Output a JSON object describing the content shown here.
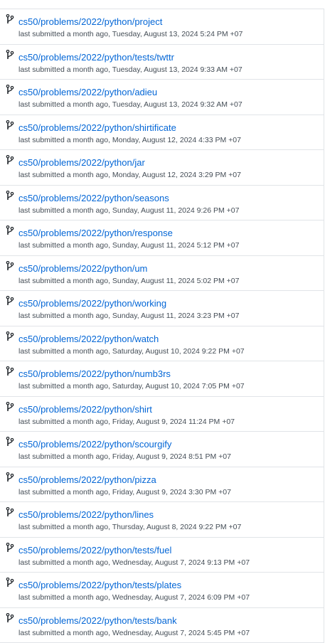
{
  "submissions": [
    {
      "repo": "cs50/problems/2022/python/project",
      "submitted": "last submitted a month ago, Tuesday, August 13, 2024 5:24 PM +07"
    },
    {
      "repo": "cs50/problems/2022/python/tests/twttr",
      "submitted": "last submitted a month ago, Tuesday, August 13, 2024 9:33 AM +07"
    },
    {
      "repo": "cs50/problems/2022/python/adieu",
      "submitted": "last submitted a month ago, Tuesday, August 13, 2024 9:32 AM +07"
    },
    {
      "repo": "cs50/problems/2022/python/shirtificate",
      "submitted": "last submitted a month ago, Monday, August 12, 2024 4:33 PM +07"
    },
    {
      "repo": "cs50/problems/2022/python/jar",
      "submitted": "last submitted a month ago, Monday, August 12, 2024 3:29 PM +07"
    },
    {
      "repo": "cs50/problems/2022/python/seasons",
      "submitted": "last submitted a month ago, Sunday, August 11, 2024 9:26 PM +07"
    },
    {
      "repo": "cs50/problems/2022/python/response",
      "submitted": "last submitted a month ago, Sunday, August 11, 2024 5:12 PM +07"
    },
    {
      "repo": "cs50/problems/2022/python/um",
      "submitted": "last submitted a month ago, Sunday, August 11, 2024 5:02 PM +07"
    },
    {
      "repo": "cs50/problems/2022/python/working",
      "submitted": "last submitted a month ago, Sunday, August 11, 2024 3:23 PM +07"
    },
    {
      "repo": "cs50/problems/2022/python/watch",
      "submitted": "last submitted a month ago, Saturday, August 10, 2024 9:22 PM +07"
    },
    {
      "repo": "cs50/problems/2022/python/numb3rs",
      "submitted": "last submitted a month ago, Saturday, August 10, 2024 7:05 PM +07"
    },
    {
      "repo": "cs50/problems/2022/python/shirt",
      "submitted": "last submitted a month ago, Friday, August 9, 2024 11:24 PM +07"
    },
    {
      "repo": "cs50/problems/2022/python/scourgify",
      "submitted": "last submitted a month ago, Friday, August 9, 2024 8:51 PM +07"
    },
    {
      "repo": "cs50/problems/2022/python/pizza",
      "submitted": "last submitted a month ago, Friday, August 9, 2024 3:30 PM +07"
    },
    {
      "repo": "cs50/problems/2022/python/lines",
      "submitted": "last submitted a month ago, Thursday, August 8, 2024 9:22 PM +07"
    },
    {
      "repo": "cs50/problems/2022/python/tests/fuel",
      "submitted": "last submitted a month ago, Wednesday, August 7, 2024 9:13 PM +07"
    },
    {
      "repo": "cs50/problems/2022/python/tests/plates",
      "submitted": "last submitted a month ago, Wednesday, August 7, 2024 6:09 PM +07"
    },
    {
      "repo": "cs50/problems/2022/python/tests/bank",
      "submitted": "last submitted a month ago, Wednesday, August 7, 2024 5:45 PM +07"
    }
  ],
  "icons": {
    "branch": "git-branch-icon"
  },
  "colors": {
    "link": "#0366d6",
    "meta": "#444d56",
    "border": "#e1e4e8",
    "icon": "#24292e"
  }
}
